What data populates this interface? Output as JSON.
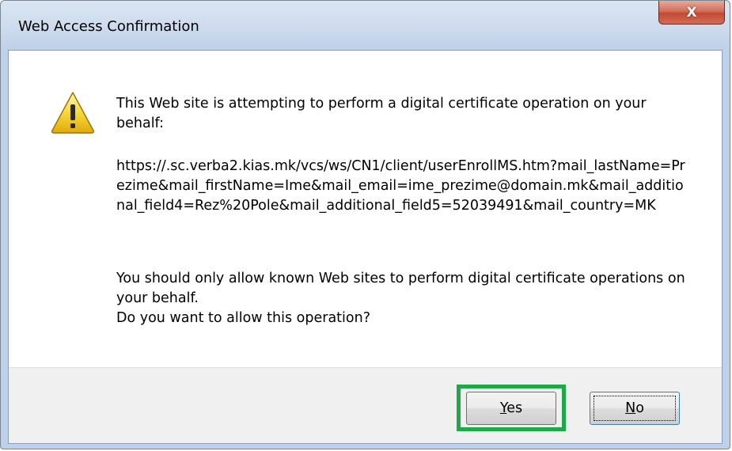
{
  "window": {
    "title": "Web Access Confirmation",
    "close_glyph": "X"
  },
  "icon": "warning-triangle-icon",
  "message": {
    "intro": "This Web site is attempting to perform a digital certificate operation on your behalf:",
    "url": "https://.sc.verba2.kias.mk/vcs/ws/CN1/client/userEnrollMS.htm?mail_lastName=Prezime&mail_firstName=Ime&mail_email=ime_prezime@domain.mk&mail_additional_field4=Rez%20Pole&mail_additional_field5=52039491&mail_country=MK",
    "warning": "You should only allow known Web sites to perform digital certificate operations on your behalf.",
    "question": "Do you want to allow this operation?"
  },
  "buttons": {
    "yes_first": "Y",
    "yes_rest": "es",
    "no_first": "N",
    "no_rest": "o"
  },
  "colors": {
    "highlight": "#1ea84a",
    "close": "#c24a33"
  }
}
